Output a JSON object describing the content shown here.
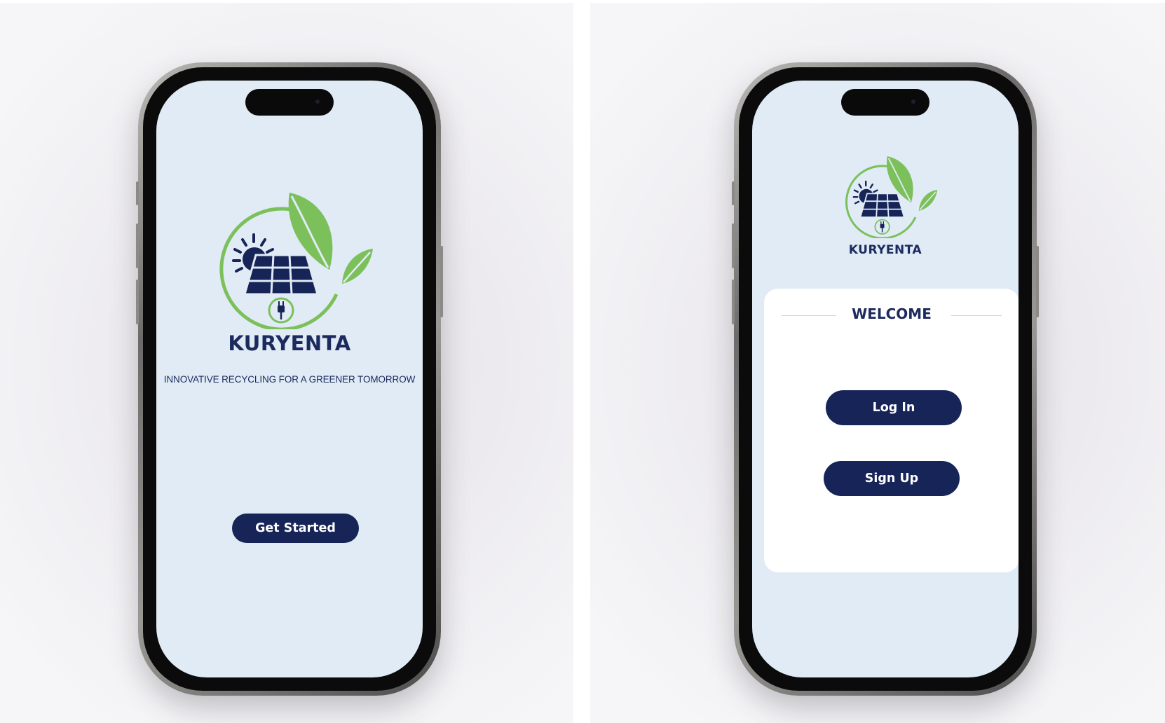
{
  "colors": {
    "navy": "#172458",
    "brand_text": "#1c2a5e",
    "screen_bg": "#e0ebf5",
    "leaf_green": "#7cc05b",
    "card_bg": "#ffffff"
  },
  "left_screen": {
    "brand_name": "KURYENTA",
    "tagline": "INNOVATIVE RECYCLING FOR A GREENER TOMORROW",
    "get_started_label": "Get Started",
    "logo_icon": "solar-panel-leaf-logo-icon"
  },
  "right_screen": {
    "brand_name": "KURYENTA",
    "welcome_title": "WELCOME",
    "login_label": "Log In",
    "signup_label": "Sign Up",
    "logo_icon": "solar-panel-leaf-logo-icon"
  }
}
